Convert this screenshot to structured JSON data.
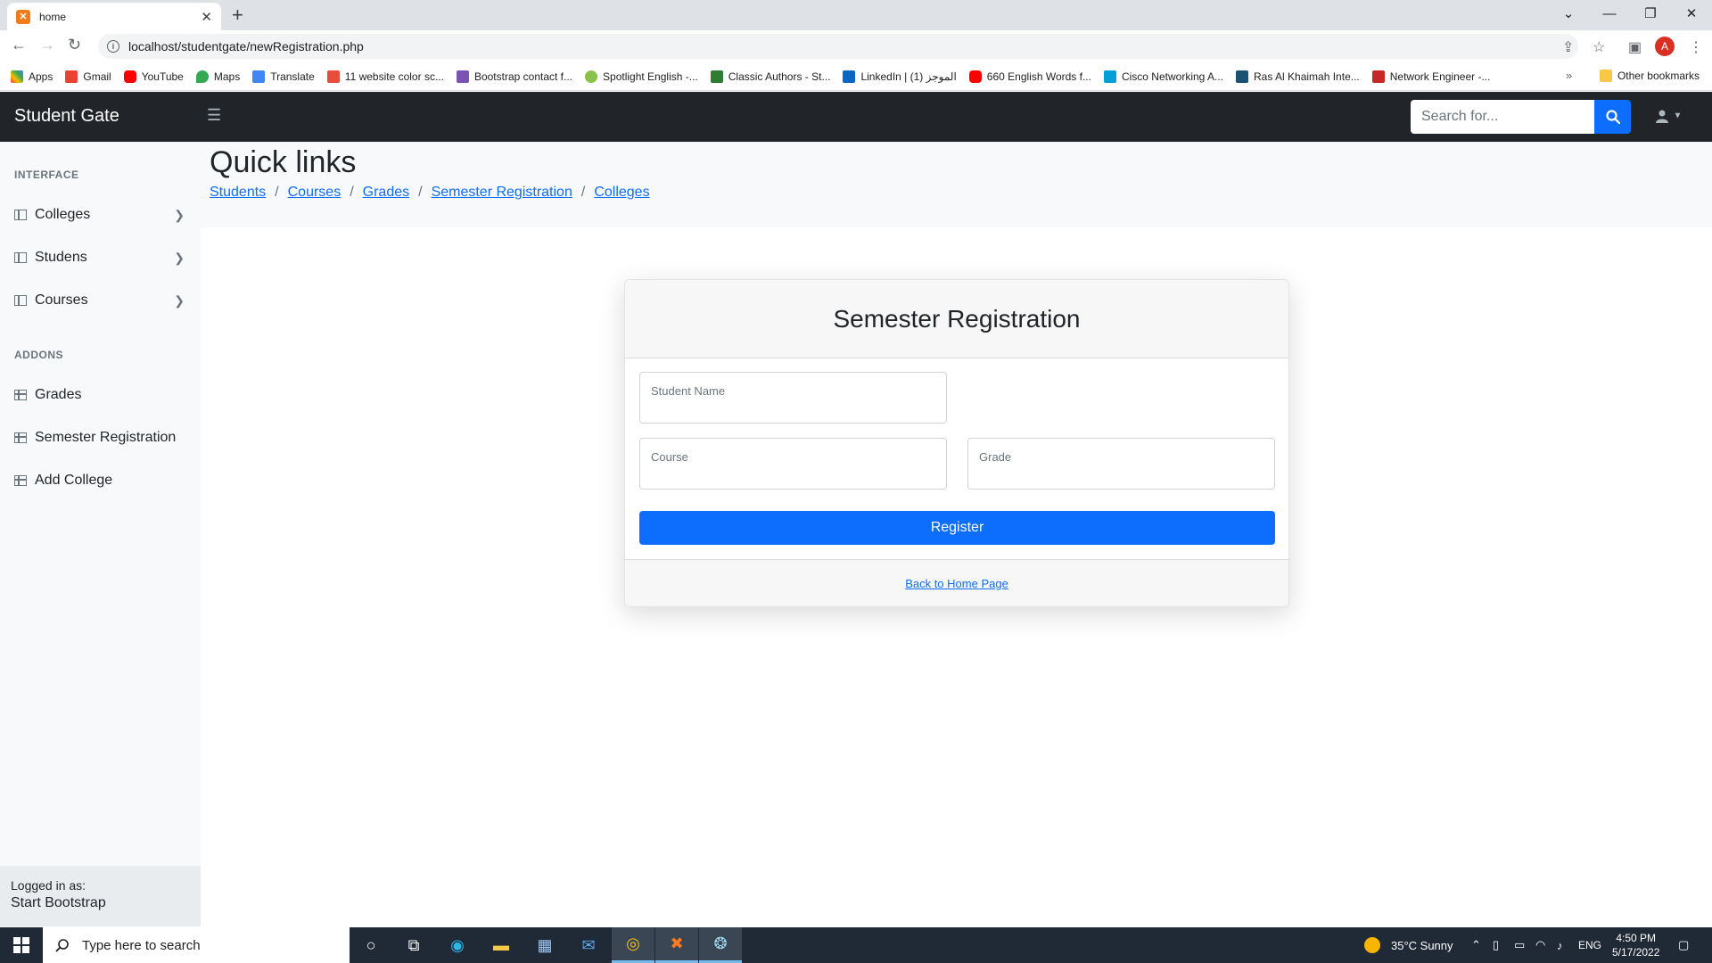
{
  "browser": {
    "tab_title": "home",
    "url": "localhost/studentgate/newRegistration.php",
    "profile_initial": "A",
    "bookmarks": [
      {
        "label": "Apps",
        "color": "#4285f4"
      },
      {
        "label": "Gmail",
        "color": "#ea4335"
      },
      {
        "label": "YouTube",
        "color": "#ff0000"
      },
      {
        "label": "Maps",
        "color": "#34a853"
      },
      {
        "label": "Translate",
        "color": "#4285f4"
      },
      {
        "label": "11 website color sc...",
        "color": "#e74c3c"
      },
      {
        "label": "Bootstrap contact f...",
        "color": "#7952b3"
      },
      {
        "label": "Spotlight English -...",
        "color": "#8bc34a"
      },
      {
        "label": "Classic Authors - St...",
        "color": "#2e7d32"
      },
      {
        "label": "LinkedIn | الموجز (1)",
        "color": "#0a66c2"
      },
      {
        "label": "660 English Words f...",
        "color": "#ff0000"
      },
      {
        "label": "Cisco Networking A...",
        "color": "#049fd9"
      },
      {
        "label": "Ras Al Khaimah Inte...",
        "color": "#1a5276"
      },
      {
        "label": "Network Engineer -...",
        "color": "#c62828"
      }
    ],
    "more_bookmarks": "»",
    "other_bookmarks": "Other bookmarks"
  },
  "app": {
    "brand": "Student Gate",
    "search_placeholder": "Search for...",
    "sidebar": {
      "heading_interface": "INTERFACE",
      "interface_items": [
        {
          "label": "Colleges"
        },
        {
          "label": "Studens"
        },
        {
          "label": "Courses"
        }
      ],
      "heading_addons": "ADDONS",
      "addon_items": [
        {
          "label": "Grades"
        },
        {
          "label": "Semester Registration"
        },
        {
          "label": "Add College"
        }
      ],
      "footer_small": "Logged in as:",
      "footer_name": "Start Bootstrap"
    },
    "quicklinks": {
      "title": "Quick links",
      "links": [
        "Students",
        "Courses",
        "Grades",
        "Semester Registration",
        "Colleges"
      ],
      "separator": "/"
    },
    "form": {
      "title": "Semester Registration",
      "student_name_label": "Student Name",
      "course_label": "Course",
      "grade_label": "Grade",
      "register_label": "Register",
      "back_link": "Back to Home Page"
    }
  },
  "taskbar": {
    "search_placeholder": "Type here to search",
    "weather": "35°C  Sunny",
    "language": "ENG",
    "time": "4:50 PM",
    "date": "5/17/2022"
  },
  "colors": {
    "primary": "#0d6efd",
    "navbar": "#212529",
    "sidebar": "#f8f9fa"
  }
}
